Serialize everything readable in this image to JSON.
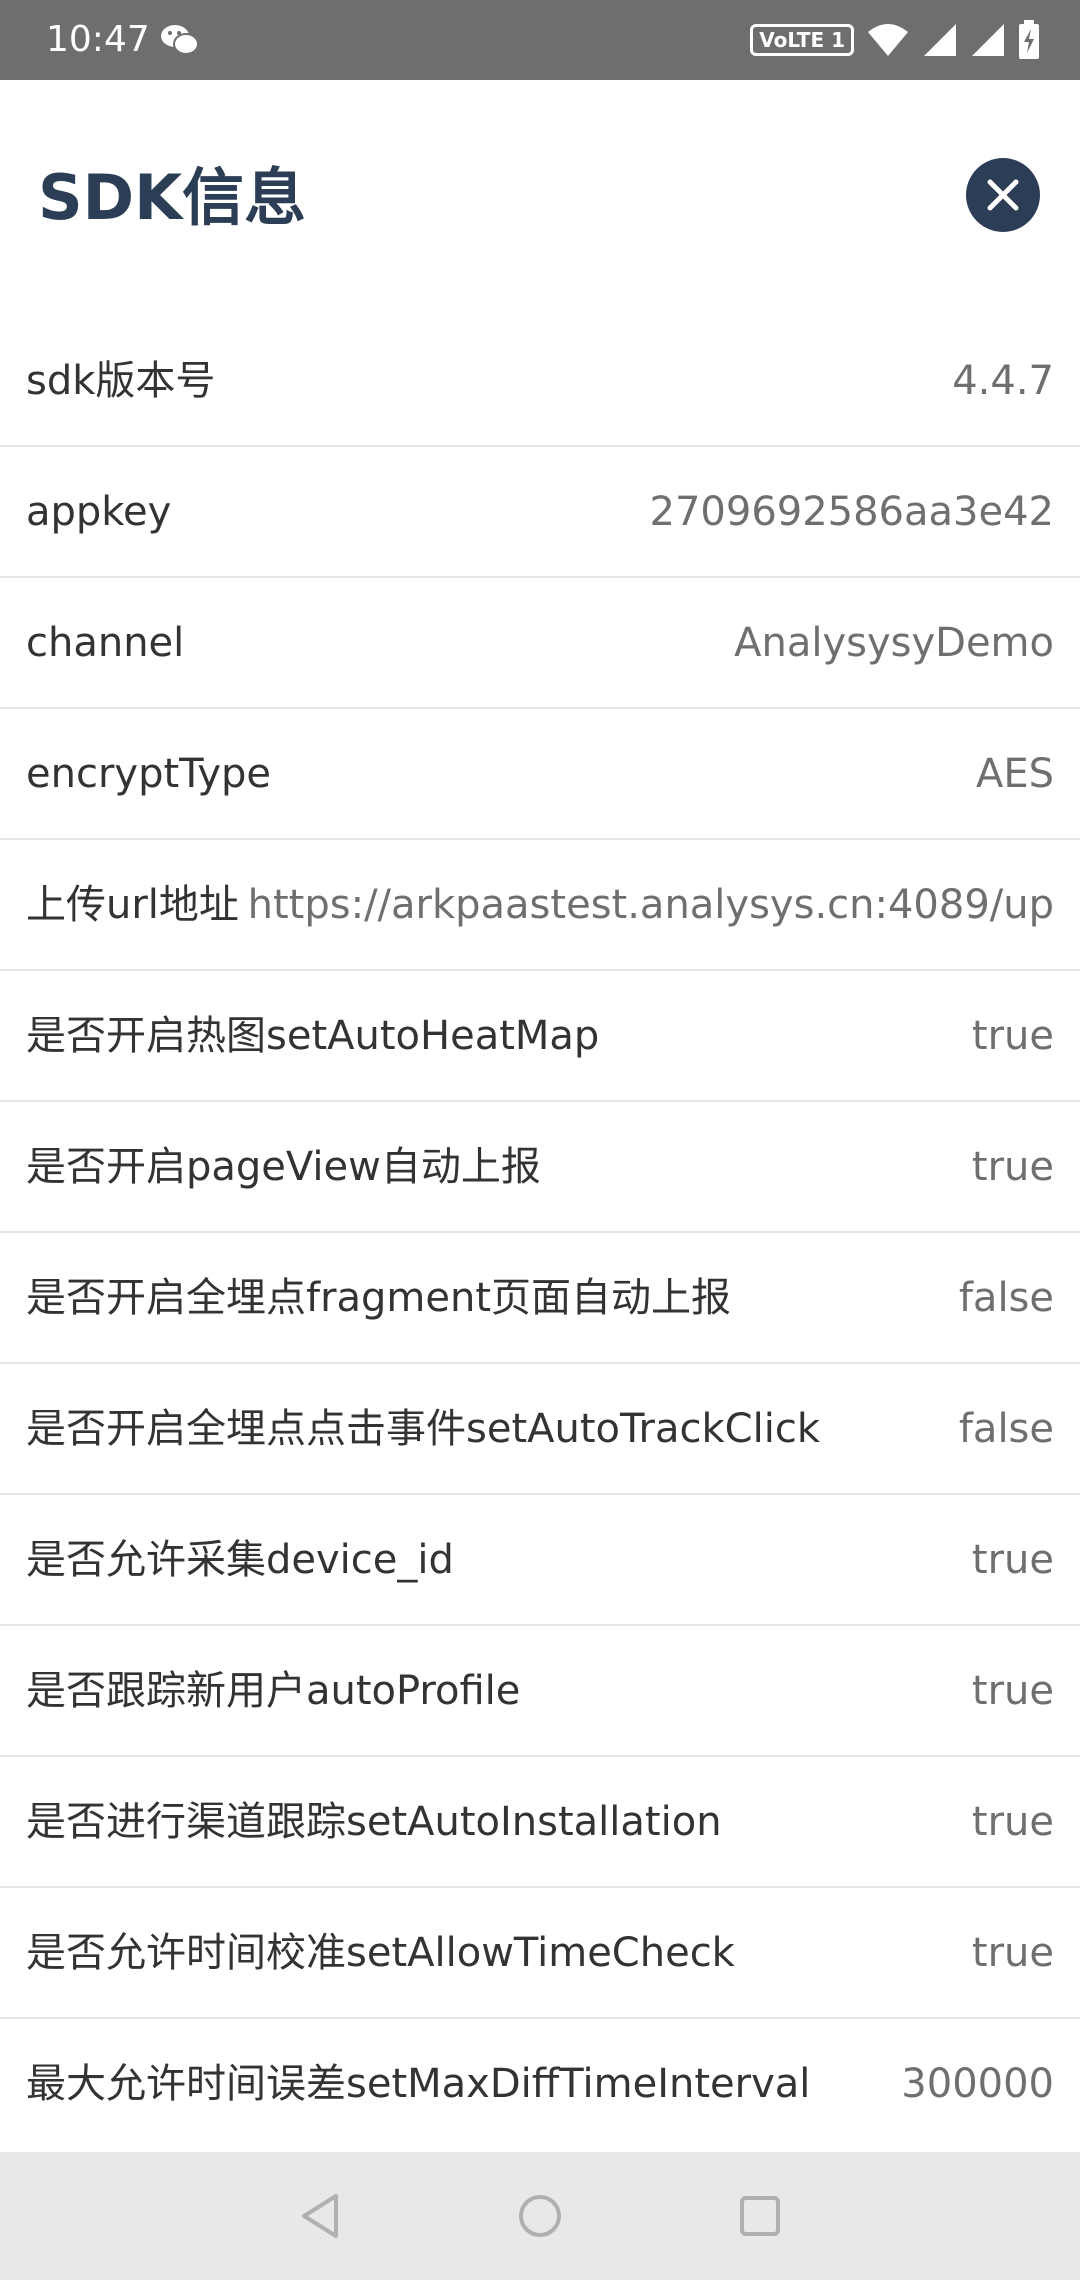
{
  "status_bar": {
    "time": "10:47",
    "volte": "VoLTE 1",
    "icons": [
      "wechat-icon",
      "wifi-icon",
      "signal-icon",
      "signal-icon",
      "battery-charging-icon"
    ]
  },
  "header": {
    "title": "SDK信息",
    "close_icon": "close-icon"
  },
  "rows": [
    {
      "label": "sdk版本号",
      "value": "4.4.7"
    },
    {
      "label": "appkey",
      "value": "2709692586aa3e42"
    },
    {
      "label": "channel",
      "value": "AnalysysyDemo"
    },
    {
      "label": "encryptType",
      "value": "AES"
    },
    {
      "label": "上传url地址",
      "value": "https://arkpaastest.analysys.cn:4089/up"
    },
    {
      "label": "是否开启热图setAutoHeatMap",
      "value": "true"
    },
    {
      "label": "是否开启pageView自动上报",
      "value": "true"
    },
    {
      "label": "是否开启全埋点fragment页面自动上报",
      "value": "false"
    },
    {
      "label": "是否开启全埋点点击事件setAutoTrackClick",
      "value": "false"
    },
    {
      "label": "是否允许采集device_id",
      "value": "true"
    },
    {
      "label": "是否跟踪新用户autoProfile",
      "value": "true"
    },
    {
      "label": "是否进行渠道跟踪setAutoInstallation",
      "value": "true"
    },
    {
      "label": "是否允许时间校准setAllowTimeCheck",
      "value": "true"
    },
    {
      "label": "最大允许时间误差setMaxDiffTimeInterval",
      "value": "300000"
    }
  ],
  "nav_bar": {
    "icons": [
      "back-icon",
      "home-icon",
      "recents-icon"
    ]
  },
  "colors": {
    "title": "#2c3e55",
    "status_bar": "#6e6e6e",
    "divider": "#e6e6e6",
    "nav_bar": "#e8e8e8"
  }
}
